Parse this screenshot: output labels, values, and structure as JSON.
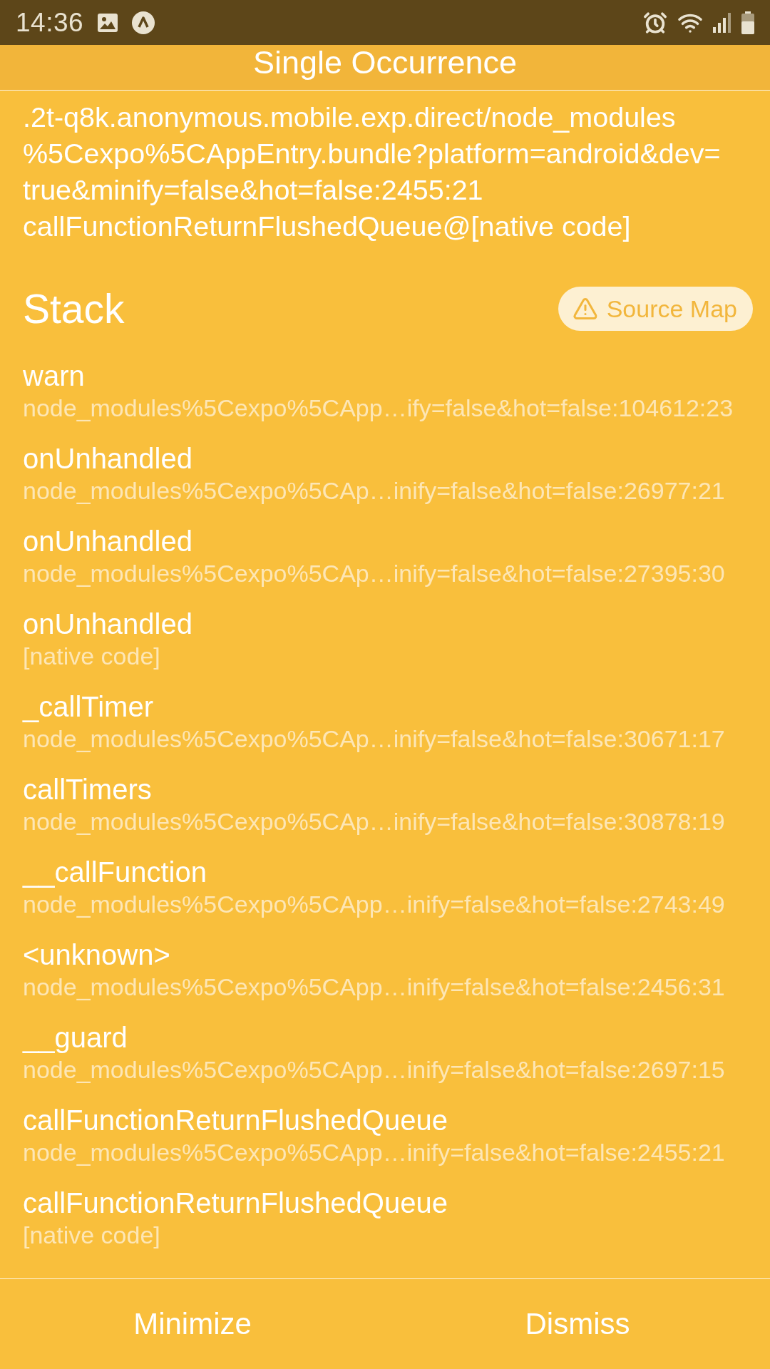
{
  "status_bar": {
    "time": "14:36"
  },
  "header": {
    "title": "Single Occurrence"
  },
  "message": {
    "lines": [
      ".2t-q8k.anonymous.mobile.exp.direct/node_modules",
      "%5Cexpo%5CAppEntry.bundle?platform=android&dev=",
      "true&minify=false&hot=false:2455:21",
      "callFunctionReturnFlushedQueue@[native code]"
    ]
  },
  "stack": {
    "title": "Stack",
    "source_map_button": "Source Map",
    "frames": [
      {
        "method": "warn",
        "location": "node_modules%5Cexpo%5CApp…ify=false&hot=false:104612:23"
      },
      {
        "method": "onUnhandled",
        "location": "node_modules%5Cexpo%5CAp…inify=false&hot=false:26977:21"
      },
      {
        "method": "onUnhandled",
        "location": "node_modules%5Cexpo%5CAp…inify=false&hot=false:27395:30"
      },
      {
        "method": "onUnhandled",
        "location": "[native code]"
      },
      {
        "method": "_callTimer",
        "location": "node_modules%5Cexpo%5CAp…inify=false&hot=false:30671:17"
      },
      {
        "method": "callTimers",
        "location": "node_modules%5Cexpo%5CAp…inify=false&hot=false:30878:19"
      },
      {
        "method": "__callFunction",
        "location": "node_modules%5Cexpo%5CApp…inify=false&hot=false:2743:49"
      },
      {
        "method": "<unknown>",
        "location": "node_modules%5Cexpo%5CApp…inify=false&hot=false:2456:31"
      },
      {
        "method": "__guard",
        "location": "node_modules%5Cexpo%5CApp…inify=false&hot=false:2697:15"
      },
      {
        "method": "callFunctionReturnFlushedQueue",
        "location": "node_modules%5Cexpo%5CApp…inify=false&hot=false:2455:21"
      },
      {
        "method": "callFunctionReturnFlushedQueue",
        "location": "[native code]"
      }
    ]
  },
  "footer": {
    "buttons": [
      "Minimize",
      "Dismiss"
    ]
  }
}
